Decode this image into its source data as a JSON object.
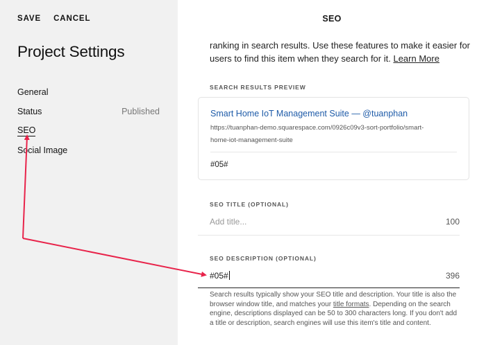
{
  "toolbar": {
    "save_label": "SAVE",
    "cancel_label": "CANCEL"
  },
  "sidebar": {
    "title": "Project Settings",
    "items": [
      {
        "label": "General",
        "value": ""
      },
      {
        "label": "Status",
        "value": "Published"
      },
      {
        "label": "SEO",
        "value": ""
      },
      {
        "label": "Social Image",
        "value": ""
      }
    ],
    "active_item": "SEO"
  },
  "panel": {
    "title": "SEO",
    "intro_text": "ranking in search results. Use these features to make it easier for users to find this item when they search for it.",
    "learn_more": "Learn More",
    "preview": {
      "label": "SEARCH RESULTS PREVIEW",
      "title": "Smart Home IoT Management Suite — @tuanphan",
      "url": "https://tuanphan-demo.squarespace.com/0926c09v3-sort-portfolio/smart-home-iot-management-suite",
      "description": "#05#"
    },
    "seo_title": {
      "label": "SEO TITLE (OPTIONAL)",
      "placeholder": "Add title...",
      "count": "100"
    },
    "seo_description": {
      "label": "SEO DESCRIPTION (OPTIONAL)",
      "value": "#05#",
      "count": "396",
      "help_before": "Search results typically show your SEO title and description. Your title is also the browser window title, and matches your",
      "help_link": "title formats",
      "help_after": ". Depending on the search engine, descriptions displayed can be 50 to 300 characters long. If you don't add a title or description, search engines will use this item's title and content."
    }
  },
  "colors": {
    "annotation_arrow": "#e8234a",
    "link": "#1e5ba8",
    "sidebar_bg": "#f1f1f1"
  }
}
